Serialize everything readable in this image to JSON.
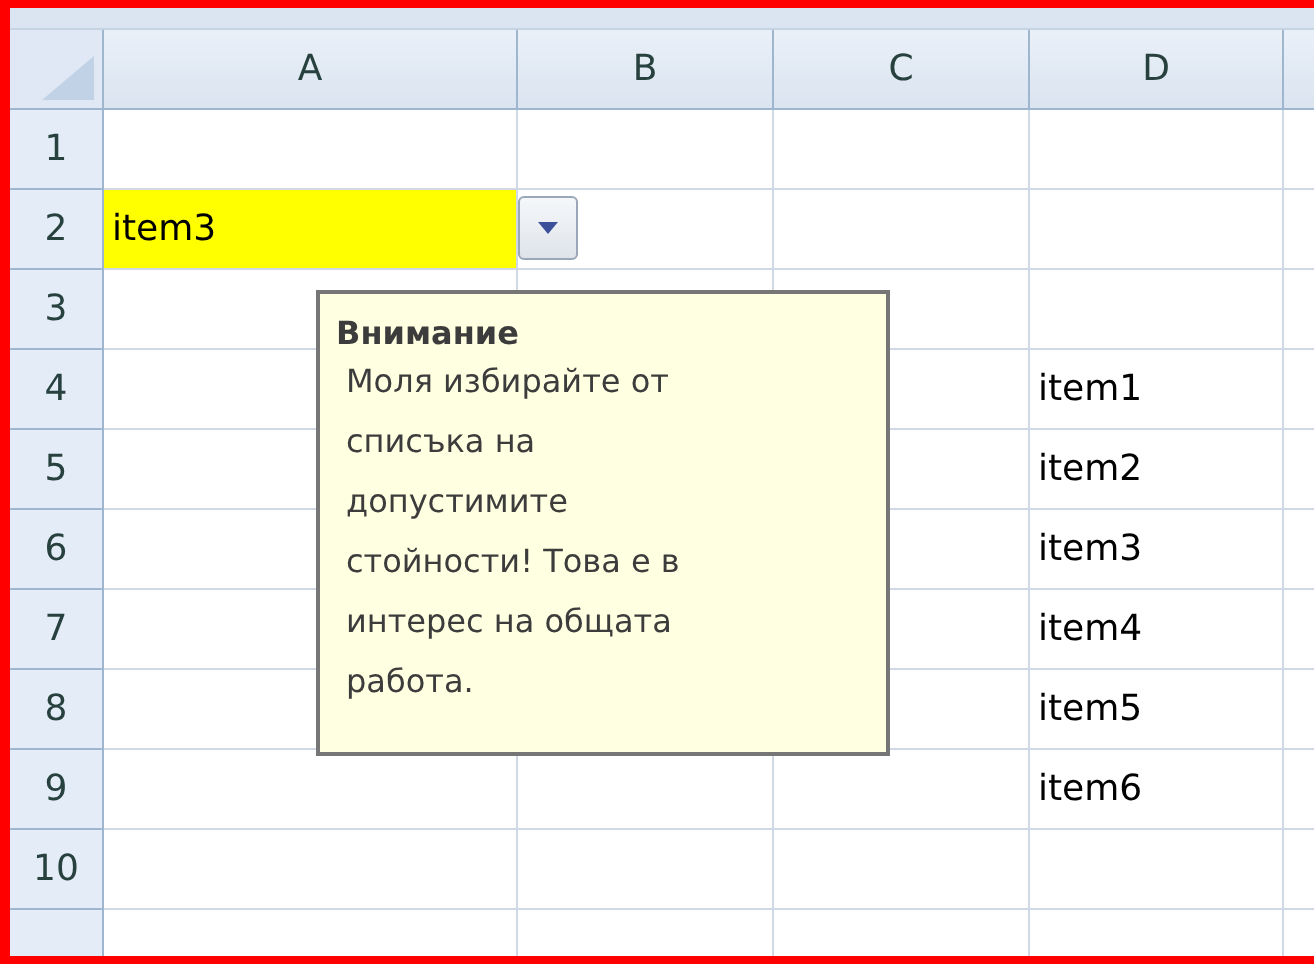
{
  "columns": [
    {
      "label": "A"
    },
    {
      "label": "B"
    },
    {
      "label": "C"
    },
    {
      "label": "D"
    }
  ],
  "rows": [
    {
      "number": "1"
    },
    {
      "number": "2",
      "a": {
        "text": "item3",
        "color": "#ffff00",
        "dropdown": true
      }
    },
    {
      "number": "3"
    },
    {
      "number": "4",
      "d": {
        "text": "item1"
      }
    },
    {
      "number": "5",
      "d": {
        "text": "item2"
      }
    },
    {
      "number": "6",
      "d": {
        "text": "item3"
      }
    },
    {
      "number": "7",
      "d": {
        "text": "item4"
      }
    },
    {
      "number": "8",
      "d": {
        "text": "item5"
      }
    },
    {
      "number": "9",
      "d": {
        "text": "item6"
      }
    },
    {
      "number": "10"
    }
  ],
  "input_message": {
    "title": "Внимание",
    "message": "Моля избирайте от списъка на допустимите стойности! Това е в интерес на общата работа."
  }
}
